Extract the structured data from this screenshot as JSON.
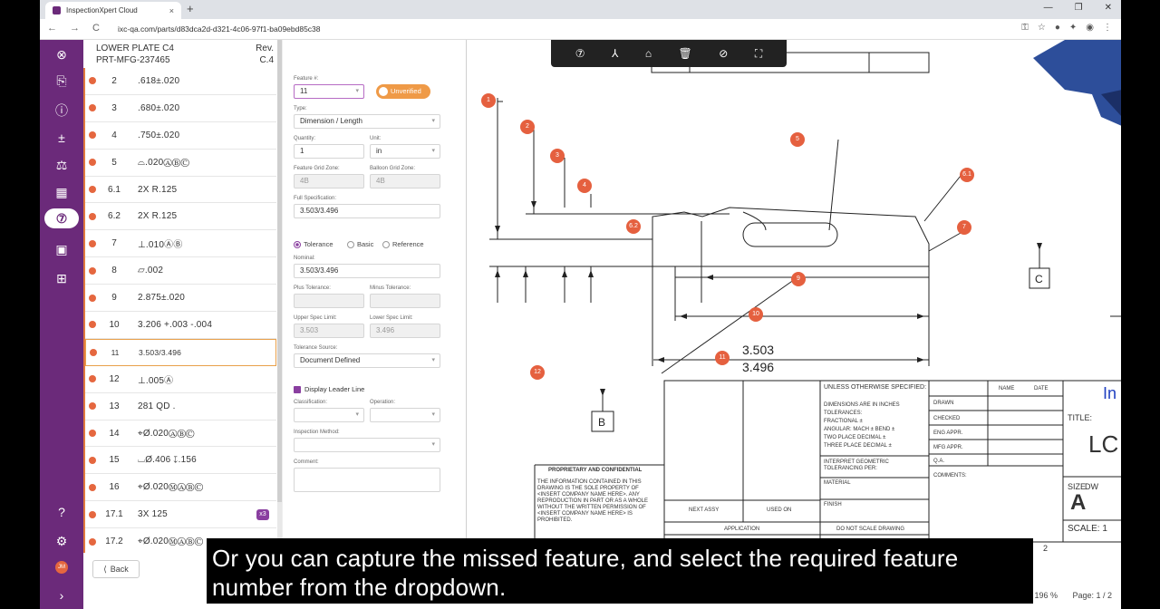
{
  "browser": {
    "tab_title": "InspectionXpert Cloud",
    "tab_close": "×",
    "new_tab": "+",
    "url": "ixc-qa.com/parts/d83dca2d-d321-4c06-97f1-ba09ebd85c38",
    "nav": [
      "←",
      "→",
      "C"
    ],
    "window_controls": [
      "—",
      "❐",
      "✕"
    ]
  },
  "part": {
    "name": "LOWER PLATE C4",
    "number": "PRT-MFG-237465",
    "rev_label": "Rev.",
    "rev_value": "C.4"
  },
  "features": [
    {
      "num": "2",
      "spec": ".618±.020"
    },
    {
      "num": "3",
      "spec": ".680±.020"
    },
    {
      "num": "4",
      "spec": ".750±.020"
    },
    {
      "num": "5",
      "spec": "⌓.020ⒶⒷⒸ"
    },
    {
      "num": "6.1",
      "spec": "2X R.125"
    },
    {
      "num": "6.2",
      "spec": "2X R.125"
    },
    {
      "num": "7",
      "spec": "⊥.010ⒶⒷ"
    },
    {
      "num": "8",
      "spec": "⏥.002"
    },
    {
      "num": "9",
      "spec": "2.875±.020"
    },
    {
      "num": "10",
      "spec": "3.206 +.003 -.004"
    },
    {
      "num": "11",
      "spec": "3.503/3.496",
      "selected": true
    },
    {
      "num": "12",
      "spec": "⊥.005Ⓐ"
    },
    {
      "num": "13",
      "spec": "281 QD ."
    },
    {
      "num": "14",
      "spec": "⌖Ø.020ⒶⒷⒸ"
    },
    {
      "num": "15",
      "spec": "⌴Ø.406 ↧.156"
    },
    {
      "num": "16",
      "spec": "⌖Ø.020ⓂⒶⒷⒸ"
    },
    {
      "num": "17.1",
      "spec": "3X 125",
      "badge": "x3"
    },
    {
      "num": "17.2",
      "spec": "⌖Ø.020ⓂⒶⒷⒸ"
    }
  ],
  "back_label": "Back",
  "props": {
    "feature_num_label": "Feature #:",
    "feature_num_value": "11",
    "status": "Unverified",
    "type_label": "Type:",
    "type_value": "Dimension / Length",
    "quantity_label": "Quantity:",
    "quantity_value": "1",
    "unit_label": "Unit:",
    "unit_value": "in",
    "grid_zone_label": "Feature Grid Zone:",
    "grid_zone_value": "4B",
    "balloon_zone_label": "Balloon Grid Zone:",
    "balloon_zone_value": "4B",
    "full_spec_label": "Full Specification:",
    "full_spec_value": "3.503/3.496",
    "radio_tolerance": "Tolerance",
    "radio_basic": "Basic",
    "radio_reference": "Reference",
    "nominal_label": "Nominal:",
    "nominal_value": "3.503/3.496",
    "plus_tol_label": "Plus Tolerance:",
    "minus_tol_label": "Minus Tolerance:",
    "usl_label": "Upper Spec Limit:",
    "usl_value": "3.503",
    "lsl_label": "Lower Spec Limit:",
    "lsl_value": "3.496",
    "tol_source_label": "Tolerance Source:",
    "tol_source_value": "Document Defined",
    "display_leader": "Display Leader Line",
    "classification_label": "Classification:",
    "operation_label": "Operation:",
    "inspection_label": "Inspection Method:",
    "comment_label": "Comment:"
  },
  "drawing": {
    "balloons": [
      "1",
      "2",
      "3",
      "4",
      "5",
      "6.1",
      "6.2",
      "7",
      "9",
      "10",
      "11",
      "12"
    ],
    "dim_upper": "3.503",
    "dim_lower": "3.496",
    "datum_b": "B",
    "datum_c": "C",
    "title_block": {
      "unless": "UNLESS OTHERWISE SPECIFIED:",
      "name": "NAME",
      "date": "DATE",
      "dims": "DIMENSIONS ARE IN INCHES",
      "tolerances": "TOLERANCES:",
      "fractional": "FRACTIONAL ±",
      "angular": "ANGULAR: MACH ±     BEND ±",
      "two_place": "TWO PLACE DECIMAL    ±",
      "three_place": "THREE PLACE DECIMAL  ±",
      "drawn": "DRAWN",
      "checked": "CHECKED",
      "eng_appr": "ENG APPR.",
      "mfg_appr": "MFG APPR.",
      "qa": "Q.A.",
      "comments": "COMMENTS:",
      "interpret": "INTERPRET GEOMETRIC TOLERANCING PER:",
      "material": "MATERIAL",
      "finish": "FINISH",
      "next_assy": "NEXT ASSY",
      "used_on": "USED ON",
      "application": "APPLICATION",
      "do_not_scale": "DO NOT SCALE DRAWING",
      "title": "TITLE:",
      "title_value": "LC",
      "size": "SIZE",
      "size_value": "A",
      "dwg": "DW",
      "scale": "SCALE: 1",
      "in": "In",
      "sheet": "2",
      "proprietary": "PROPRIETARY AND CONFIDENTIAL",
      "proprietary_text": "THE INFORMATION CONTAINED IN THIS DRAWING IS THE SOLE PROPERTY OF <INSERT COMPANY NAME HERE>. ANY REPRODUCTION IN PART OR AS A WHOLE WITHOUT THE WRITTEN PERMISSION OF <INSERT COMPANY NAME HERE> IS PROHIBITED."
    }
  },
  "status": {
    "zoom": "196 %",
    "page": "Page: 1 / 2"
  },
  "caption_line1": "Or you can capture the missed feature, and select the required feature",
  "caption_line2": "number from the dropdown."
}
